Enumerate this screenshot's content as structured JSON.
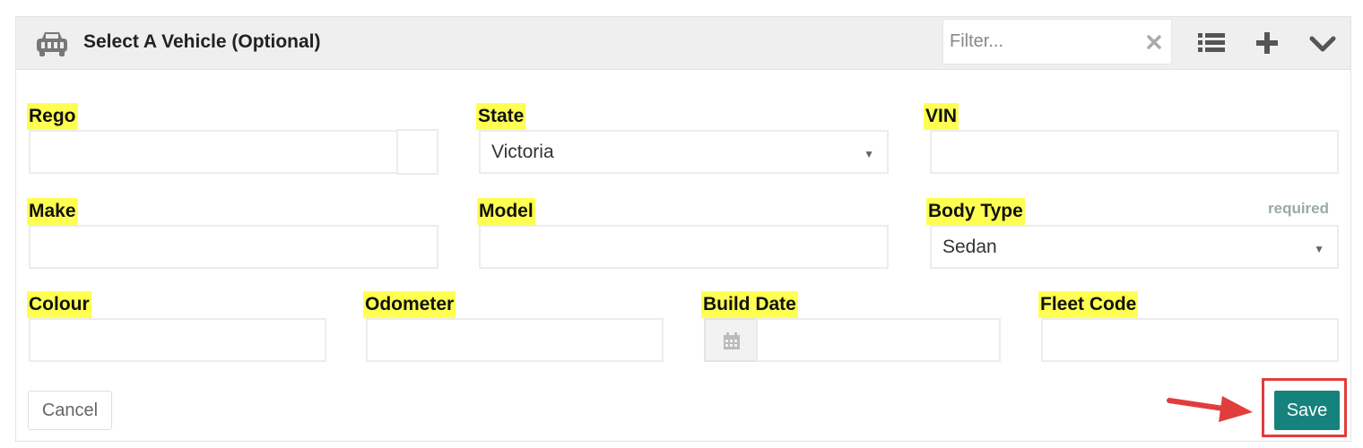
{
  "header": {
    "title": "Select A Vehicle (Optional)",
    "filter_placeholder": "Filter...",
    "icons": [
      "car-icon",
      "clear-icon",
      "list-icon",
      "plus-icon",
      "chevron-down-icon"
    ]
  },
  "form": {
    "rego_label": "Rego",
    "state_label": "State",
    "state_value": "Victoria",
    "vin_label": "VIN",
    "make_label": "Make",
    "model_label": "Model",
    "body_type_label": "Body Type",
    "body_type_required": "required",
    "body_type_value": "Sedan",
    "colour_label": "Colour",
    "odometer_label": "Odometer",
    "build_date_label": "Build Date",
    "fleet_code_label": "Fleet Code"
  },
  "actions": {
    "cancel_label": "Cancel",
    "save_label": "Save"
  },
  "colors": {
    "label_highlight": "#ffff52",
    "save_button": "#16827d",
    "annotation_red": "#e23d3d"
  }
}
